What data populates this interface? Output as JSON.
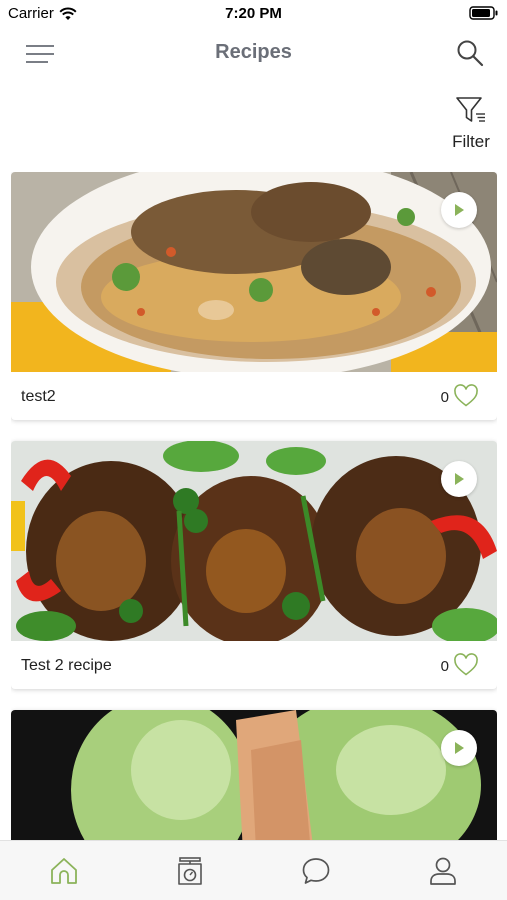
{
  "status_bar": {
    "carrier": "Carrier",
    "time": "7:20 PM"
  },
  "header": {
    "title": "Recipes",
    "filter_label": "Filter"
  },
  "recipes": [
    {
      "name": "test2",
      "likes": "0"
    },
    {
      "name": "Test 2 recipe",
      "likes": "0"
    },
    {
      "name": "",
      "likes": ""
    }
  ],
  "colors": {
    "accent": "#8bb35a",
    "title": "#6b6f78"
  },
  "icons": {
    "menu": "hamburger-icon",
    "search": "search-icon",
    "filter": "filter-icon",
    "play": "play-icon",
    "like": "heart-icon",
    "tabs": [
      "home-icon",
      "scale-icon",
      "chat-icon",
      "profile-icon"
    ]
  }
}
